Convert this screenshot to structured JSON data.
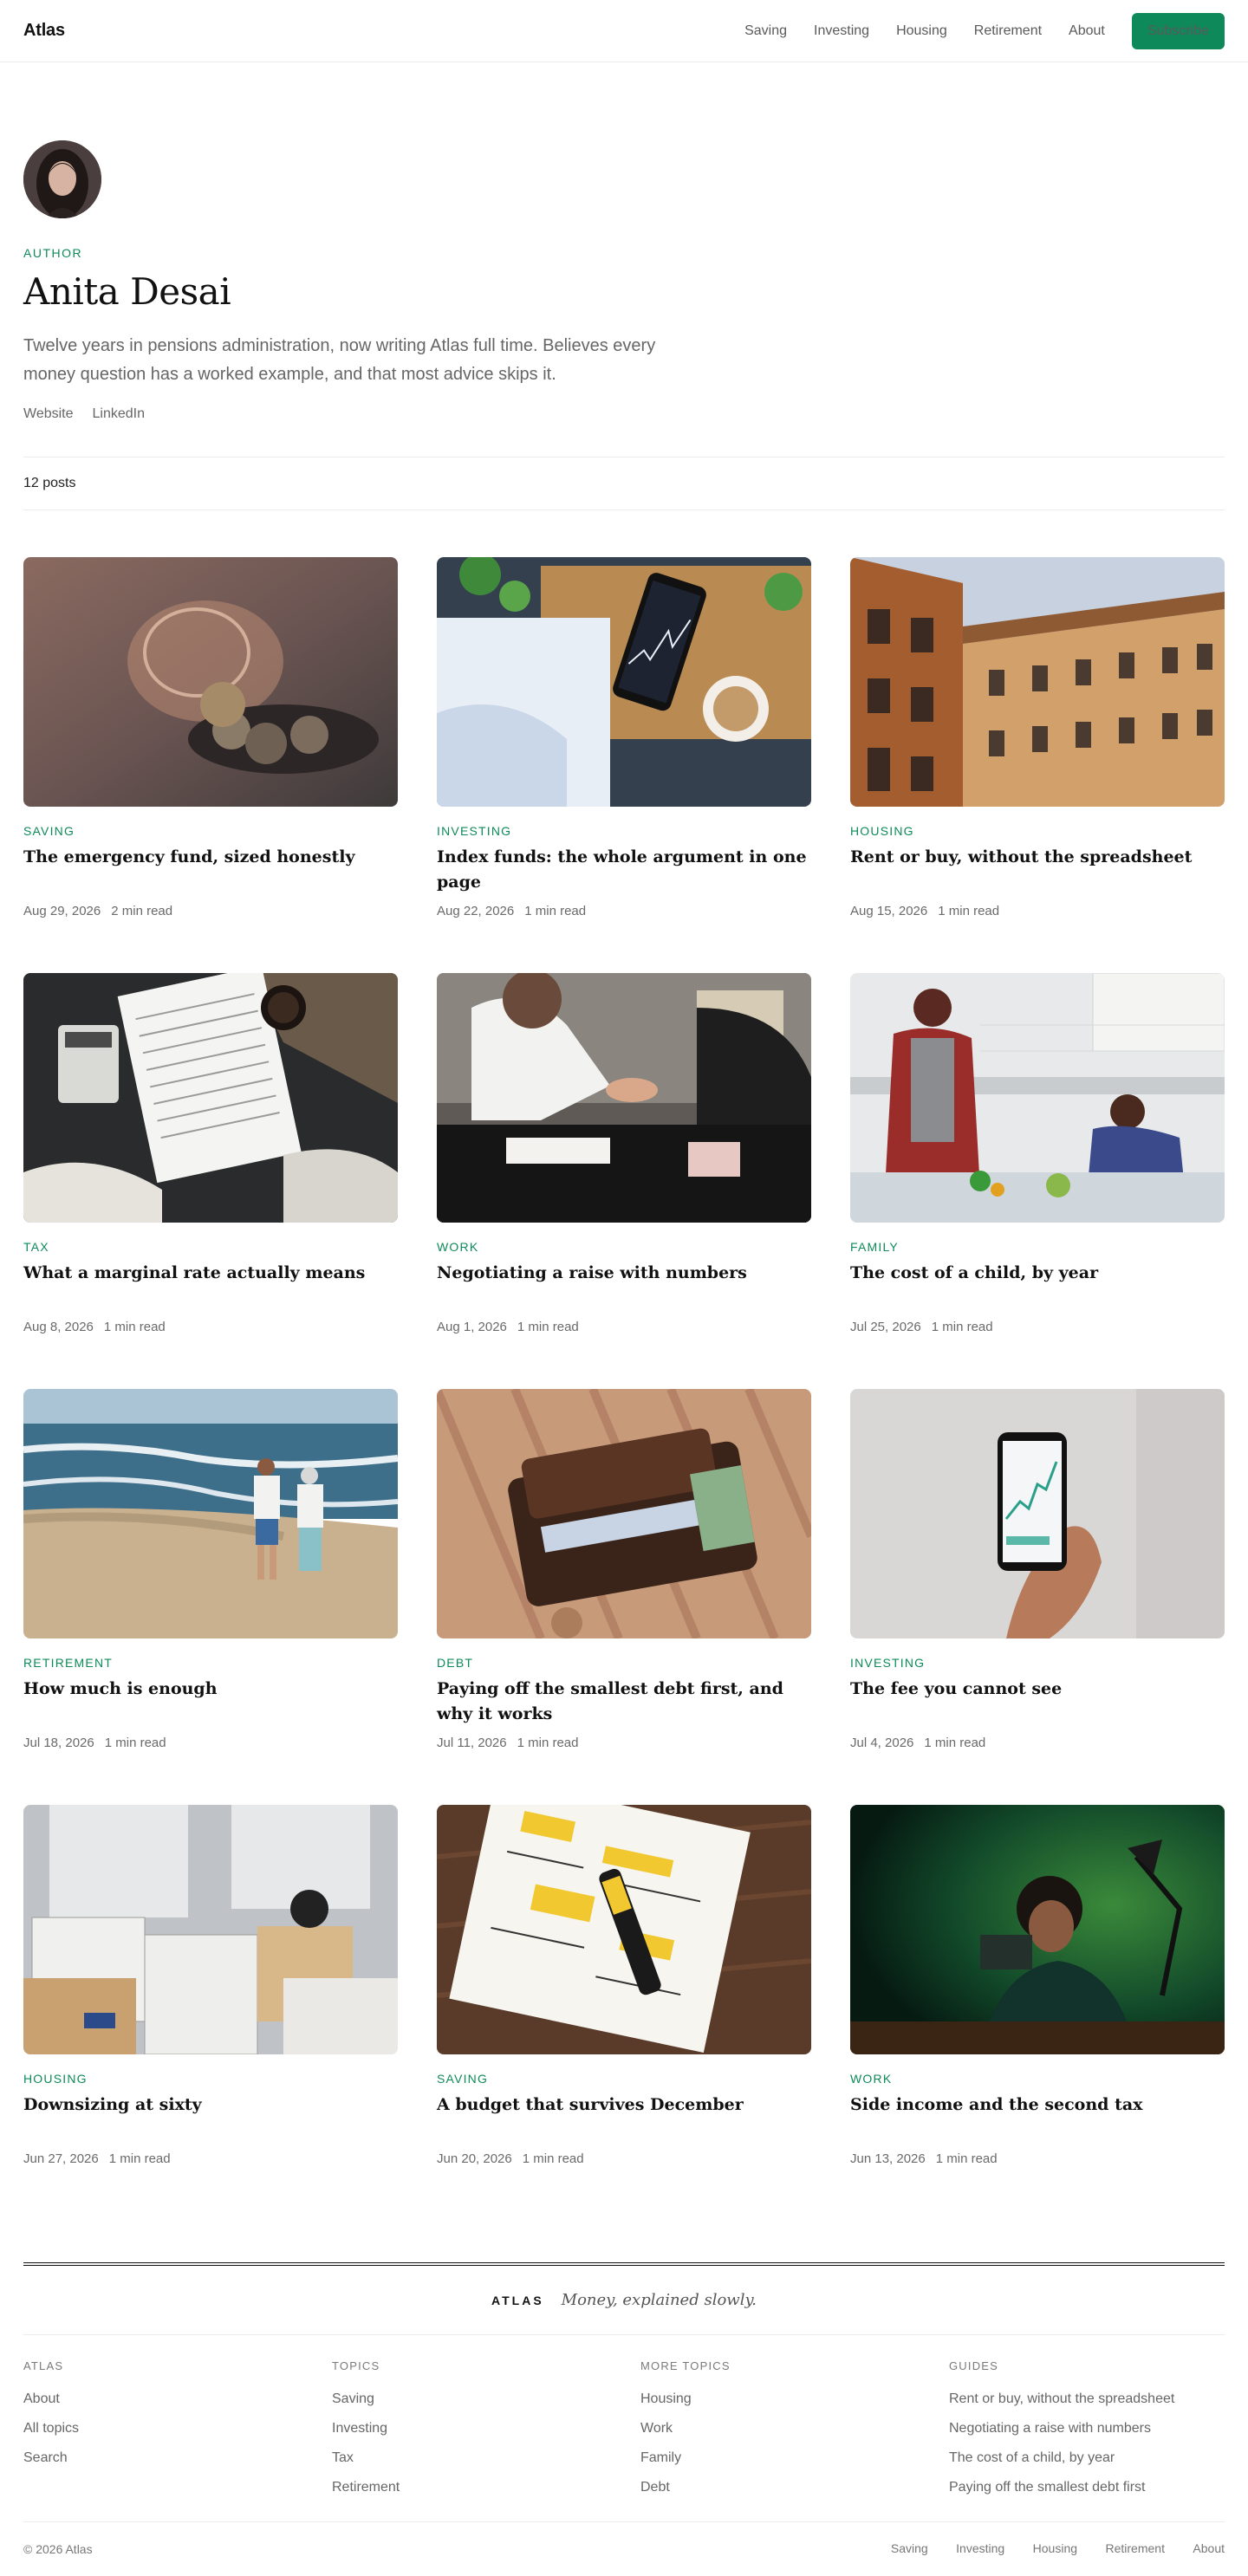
{
  "header": {
    "brand": "Atlas",
    "nav": [
      "Saving",
      "Investing",
      "Housing",
      "Retirement",
      "About"
    ],
    "subscribe": "Subscribe",
    "accent": "#0e8a5a"
  },
  "author": {
    "eyebrow": "Author",
    "name": "Anita Desai",
    "bio": "Twelve years in pensions administration, now writing Atlas full time. Believes every money question has a worked example, and that most advice skips it.",
    "links": [
      "Website",
      "LinkedIn"
    ],
    "post_count": "12 posts"
  },
  "posts": [
    {
      "tag": "Saving",
      "title": "The emergency fund, sized honestly",
      "date": "Aug 29, 2026",
      "read": "2 min read",
      "image": "coin-jar"
    },
    {
      "tag": "Investing",
      "title": "Index funds: the whole argument in one page",
      "date": "Aug 22, 2026",
      "read": "1 min read",
      "image": "phone-chart-coffee"
    },
    {
      "tag": "Housing",
      "title": "Rent or buy, without the spreadsheet",
      "date": "Aug 15, 2026",
      "read": "1 min read",
      "image": "building"
    },
    {
      "tag": "Tax",
      "title": "What a marginal rate actually means",
      "date": "Aug 8, 2026",
      "read": "1 min read",
      "image": "tax-form"
    },
    {
      "tag": "Work",
      "title": "Negotiating a raise with numbers",
      "date": "Aug 1, 2026",
      "read": "1 min read",
      "image": "handshake"
    },
    {
      "tag": "Family",
      "title": "The cost of a child, by year",
      "date": "Jul 25, 2026",
      "read": "1 min read",
      "image": "kitchen-family"
    },
    {
      "tag": "Retirement",
      "title": "How much is enough",
      "date": "Jul 18, 2026",
      "read": "1 min read",
      "image": "beach-couple"
    },
    {
      "tag": "Debt",
      "title": "Paying off the smallest debt first, and why it works",
      "date": "Jul 11, 2026",
      "read": "1 min read",
      "image": "wallet"
    },
    {
      "tag": "Investing",
      "title": "The fee you cannot see",
      "date": "Jul 4, 2026",
      "read": "1 min read",
      "image": "hand-phone"
    },
    {
      "tag": "Housing",
      "title": "Downsizing at sixty",
      "date": "Jun 27, 2026",
      "read": "1 min read",
      "image": "moving-boxes"
    },
    {
      "tag": "Saving",
      "title": "A budget that survives December",
      "date": "Jun 20, 2026",
      "read": "1 min read",
      "image": "notebook"
    },
    {
      "tag": "Work",
      "title": "Side income and the second tax",
      "date": "Jun 13, 2026",
      "read": "1 min read",
      "image": "desk-lamp"
    }
  ],
  "footer": {
    "brand": "ATLAS",
    "tagline": "Money, explained slowly.",
    "columns": [
      {
        "head": "Atlas",
        "links": [
          "About",
          "All topics",
          "Search"
        ]
      },
      {
        "head": "Topics",
        "links": [
          "Saving",
          "Investing",
          "Tax",
          "Retirement"
        ]
      },
      {
        "head": "More topics",
        "links": [
          "Housing",
          "Work",
          "Family",
          "Debt"
        ]
      },
      {
        "head": "Guides",
        "links": [
          "Rent or buy, without the spreadsheet",
          "Negotiating a raise with numbers",
          "The cost of a child, by year",
          "Paying off the smallest debt first"
        ]
      }
    ],
    "copyright": "© 2026 Atlas",
    "bottom_nav": [
      "Saving",
      "Investing",
      "Housing",
      "Retirement",
      "About"
    ]
  }
}
